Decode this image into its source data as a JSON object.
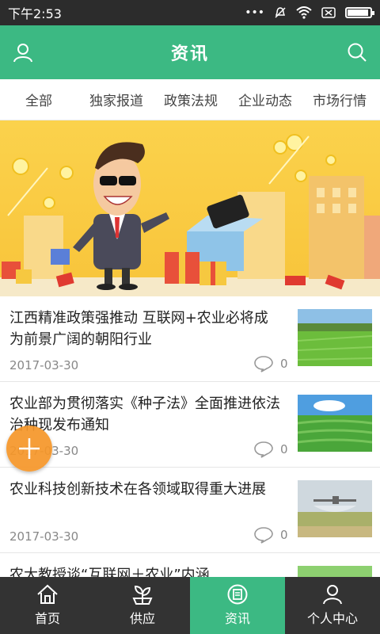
{
  "status_bar": {
    "time": "下午2:53",
    "icons": [
      "more-dots-icon",
      "mute-icon",
      "wifi-icon",
      "sim-icon",
      "battery-icon"
    ]
  },
  "header": {
    "title": "资讯",
    "left_icon": "user-icon",
    "right_icon": "search-icon"
  },
  "tabs": [
    "全部",
    "独家报道",
    "政策法规",
    "企业动态",
    "市场行情"
  ],
  "news": [
    {
      "title": "江西精准政策强推动 互联网+农业必将成为前景广阔的朝阳行业",
      "date": "2017-03-30",
      "comments": "0"
    },
    {
      "title": "农业部为贯彻落实《种子法》全面推进依法治种现发布通知",
      "date": "2017-03-30",
      "comments": "0"
    },
    {
      "title": "农业科技创新技术在各领域取得重大进展",
      "date": "2017-03-30",
      "comments": "0"
    },
    {
      "title": "农大教授谈“互联网＋农业”内涵",
      "date": "",
      "comments": ""
    }
  ],
  "bottom_nav": [
    {
      "label": "首页",
      "icon": "home-icon"
    },
    {
      "label": "供应",
      "icon": "plant-icon"
    },
    {
      "label": "资讯",
      "icon": "news-icon"
    },
    {
      "label": "个人中心",
      "icon": "profile-icon"
    }
  ],
  "colors": {
    "brand_green": "#3cb983",
    "fab_orange": "#f59628",
    "nav_dark": "#333333"
  }
}
